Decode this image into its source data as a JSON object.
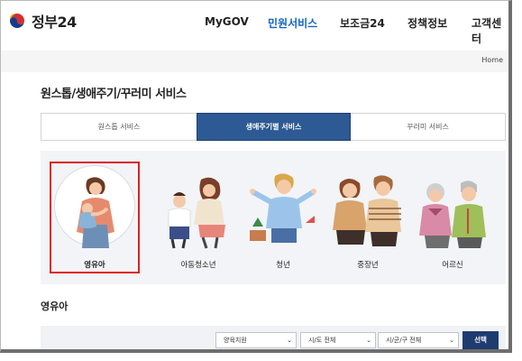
{
  "header": {
    "logo_text": "정부24",
    "nav": [
      "MyGOV",
      "민원서비스",
      "보조금24",
      "정책정보",
      "고객센터"
    ],
    "active_nav": "민원서비스"
  },
  "breadcrumb": {
    "home": "Home"
  },
  "page_title": "원스톱/생애주기/꾸러미 서비스",
  "tabs": [
    {
      "label": "원스톱 서비스",
      "active": false
    },
    {
      "label": "생애주기별 서비스",
      "active": true
    },
    {
      "label": "꾸러미 서비스",
      "active": false
    }
  ],
  "life_stages": [
    {
      "label": "영유아",
      "icon": "infant-mother-illustration",
      "selected": true
    },
    {
      "label": "아동청소년",
      "icon": "children-illustration",
      "selected": false
    },
    {
      "label": "청년",
      "icon": "youth-illustration",
      "selected": false
    },
    {
      "label": "중장년",
      "icon": "middle-age-couple-illustration",
      "selected": false
    },
    {
      "label": "어르신",
      "icon": "senior-couple-illustration",
      "selected": false
    }
  ],
  "section": {
    "title": "영유아"
  },
  "filters": {
    "category": "양육지원",
    "province": "시/도 전체",
    "district": "시/군/구 전체",
    "select_button": "선택"
  },
  "colors": {
    "accent": "#2d5a94",
    "active_nav": "#1565c0",
    "selection_border": "#e02020",
    "button": "#1f3c70"
  }
}
